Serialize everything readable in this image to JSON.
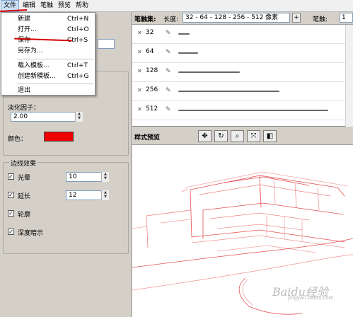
{
  "menubar": {
    "items": [
      "文件",
      "编辑",
      "笔触",
      "预览",
      "帮助"
    ]
  },
  "file_menu": {
    "items": [
      {
        "label": "新建",
        "shortcut": "Ctrl+N"
      },
      {
        "label": "打开...",
        "shortcut": "Ctrl+O"
      },
      {
        "label": "保存",
        "shortcut": "Ctrl+S"
      },
      {
        "label": "另存为...",
        "shortcut": ""
      },
      {
        "label": "载入模板...",
        "shortcut": "Ctrl+T"
      },
      {
        "label": "创建新模板...",
        "shortcut": "Ctrl+G"
      },
      {
        "label": "退出",
        "shortcut": ""
      }
    ]
  },
  "left_panel": {
    "fade_label": "淡化因子：",
    "fade_value": "2.00",
    "color_label": "颜色：",
    "color_value": "#ee0000",
    "edge_group_title": "边线效果",
    "effects": [
      {
        "label": "光晕",
        "checked": true,
        "value": "10"
      },
      {
        "label": "延长",
        "checked": true,
        "value": "12"
      },
      {
        "label": "轮廓",
        "checked": true
      },
      {
        "label": "深度暗示",
        "checked": true
      }
    ]
  },
  "brush_panel": {
    "set_label": "笔触集:",
    "length_label": "长度:",
    "length_value": "32 - 64 - 128 - 256 - 512 像素",
    "add_button": "+",
    "brush_label": "笔触:",
    "brush_value": "1",
    "rows": [
      {
        "num": "32",
        "stroke_fraction": 0.07
      },
      {
        "num": "64",
        "stroke_fraction": 0.12
      },
      {
        "num": "128",
        "stroke_fraction": 0.38
      },
      {
        "num": "256",
        "stroke_fraction": 0.62
      },
      {
        "num": "512",
        "stroke_fraction": 0.92
      }
    ]
  },
  "preview_panel": {
    "title": "样式预览",
    "watermark": "Baidu经验",
    "watermark_url": "jingyan.baidu.com",
    "tools": [
      "move-icon",
      "rotate-icon",
      "zoom-icon",
      "fit-icon",
      "cube-icon"
    ]
  }
}
